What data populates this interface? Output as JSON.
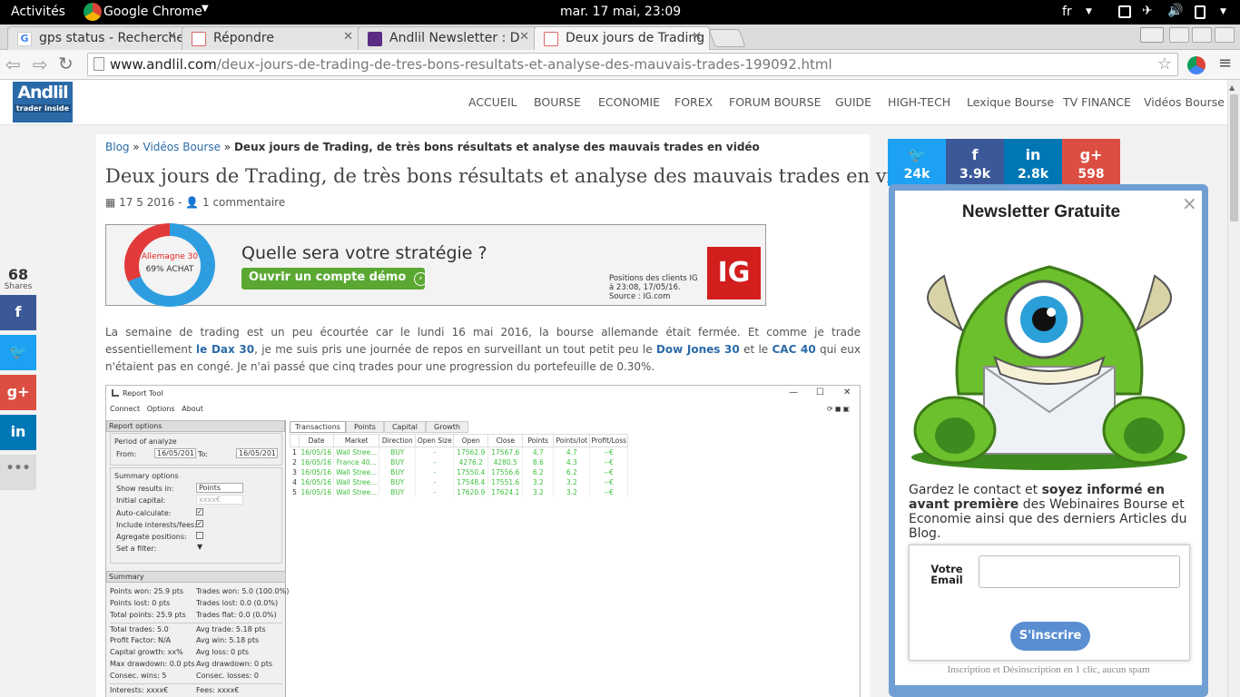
{
  "system_bar": {
    "activities": "Activités",
    "app": "Google Chrome",
    "clock": "mar. 17 mai, 23:09",
    "lang": "fr"
  },
  "tabs": [
    {
      "label": "gps status - Recherche"
    },
    {
      "label": "Répondre"
    },
    {
      "label": "Andlil Newsletter : D"
    },
    {
      "label": "Deux jours de Trading"
    }
  ],
  "url": {
    "host": "www.andlil.com",
    "path": "/deux-jours-de-trading-de-tres-bons-resultats-et-analyse-des-mauvais-trades-199092.html"
  },
  "site": {
    "logo_top": "Andlil",
    "logo_bottom": "trader inside"
  },
  "nav": [
    "ACCUEIL",
    "BOURSE",
    "ECONOMIE",
    "FOREX",
    "FORUM BOURSE",
    "GUIDE",
    "HIGH-TECH",
    "Lexique Bourse",
    "TV FINANCE",
    "Vidéos Bourse"
  ],
  "breadcrumb": {
    "blog": "Blog",
    "sep": "»",
    "section": "Vidéos Bourse",
    "current": "Deux jours de Trading, de très bons résultats et analyse des mauvais trades en vidéo"
  },
  "article": {
    "title": "Deux jours de Trading, de très bons résultats et analyse des mauvais trades en vidéo",
    "date": "17 5 2016",
    "comments": "1 commentaire",
    "p_pre": "La semaine de trading est un peu écourtée car le lundi 16 mai 2016, la bourse allemande était fermée. Et comme je trade essentiellement ",
    "link_dax": "le Dax 30",
    "p_mid1": ", je me suis pris une journée de repos en surveillant un tout petit peu le ",
    "link_dow": "Dow Jones 30",
    "p_mid2": " et le ",
    "link_cac": "CAC 40",
    "p_post": " qui eux n'étaient pas en congé. Je n'ai passé que cinq trades pour une progression du portefeuille de 0.30%."
  },
  "ad": {
    "donut_label": "Allemagne 30",
    "donut_value": "69% ACHAT",
    "achat_fraction": 0.69,
    "headline": "Quelle sera votre stratégie ?",
    "cta": "Ouvrir un compte démo",
    "note1": "Positions des clients IG",
    "note2": "à 23:08, 17/05/16.",
    "note3": "Source : IG.com",
    "brand": "IG"
  },
  "report": {
    "title": "Report Tool",
    "menu": [
      "Connect",
      "Options",
      "About"
    ],
    "left_header": "Report options",
    "period": "Period of analyze",
    "from_label": "From:",
    "from": "16/05/201",
    "to_label": "To:",
    "to": "16/05/201",
    "summary_options": "Summary options",
    "show_results": "Show results in:",
    "show_value": "Points",
    "initial_capital": "Initial capital:",
    "capital_value": "xxxx€",
    "auto_calc": "Auto-calculate:",
    "incl_interests": "Include interests/fees:",
    "aggregate": "Agregate positions:",
    "set_filter": "Set a filter:",
    "summary_header": "Summary",
    "summary": [
      [
        "Points won: 25.9 pts",
        "Trades won: 5.0 (100.0%)"
      ],
      [
        "Points lost: 0 pts",
        "Trades lost: 0.0 (0.0%)"
      ],
      [
        "Total points: 25.9 pts",
        "Trades flat: 0.0 (0.0%)"
      ],
      [
        "Total trades: 5.0",
        "Avg trade: 5.18 pts"
      ],
      [
        "Profit Factor: N/A",
        "Avg win: 5.18 pts"
      ],
      [
        "Capital growth: xx%",
        "Avg loss: 0 pts"
      ],
      [
        "Max drawdown: 0.0 pts",
        "Avg drawdown: 0 pts"
      ],
      [
        "Consec. wins: 5",
        "Consec. losses: 0"
      ],
      [
        "Interests: xxxx€",
        "Fees: xxxx€"
      ]
    ],
    "tabs": [
      "Transactions",
      "Points",
      "Capital",
      "Growth"
    ],
    "columns": [
      "Date",
      "Market",
      "Direction",
      "Open Size",
      "Open",
      "Close",
      "Points",
      "Points/lot",
      "Profit/Loss"
    ],
    "rows": [
      [
        "1",
        "16/05/16",
        "Wall Stree...",
        "BUY",
        "-",
        "17562.9",
        "17567.6",
        "4.7",
        "4.7",
        "--€"
      ],
      [
        "2",
        "16/05/16",
        "France 40...",
        "BUY",
        "-",
        "4276.2",
        "4280.5",
        "8.6",
        "4.3",
        "--€"
      ],
      [
        "3",
        "16/05/16",
        "Wall Stree...",
        "BUY",
        "-",
        "17550.4",
        "17556.6",
        "6.2",
        "6.2",
        "--€"
      ],
      [
        "4",
        "16/05/16",
        "Wall Stree...",
        "BUY",
        "-",
        "17548.4",
        "17551.6",
        "3.2",
        "3.2",
        "--€"
      ],
      [
        "5",
        "16/05/16",
        "Wall Stree...",
        "BUY",
        "-",
        "17620.9",
        "17624.1",
        "3.2",
        "3.2",
        "--€"
      ]
    ]
  },
  "share": {
    "count": "68",
    "label": "Shares"
  },
  "social": [
    {
      "name": "twitter",
      "icon": "𝕏",
      "count": "24k",
      "color": "#1da1f2"
    },
    {
      "name": "facebook",
      "icon": "f",
      "count": "3.9k",
      "color": "#3b5998"
    },
    {
      "name": "linkedin",
      "icon": "in",
      "count": "2.8k",
      "color": "#0077b5"
    },
    {
      "name": "google-plus",
      "icon": "g+",
      "count": "598",
      "color": "#dc4e41"
    }
  ],
  "newsletter": {
    "title": "Newsletter Gratuite",
    "close": "×",
    "text_pre": "Gardez le contact et ",
    "text_bold": "soyez informé en avant première",
    "text_post": " des Webinaires Bourse et Economie ainsi que des derniers Articles du Blog.",
    "email_label": "Votre Email",
    "email_value": "",
    "submit": "S'inscrire",
    "footer": "Inscription et Désinscription en 1 clic, aucun spam"
  }
}
